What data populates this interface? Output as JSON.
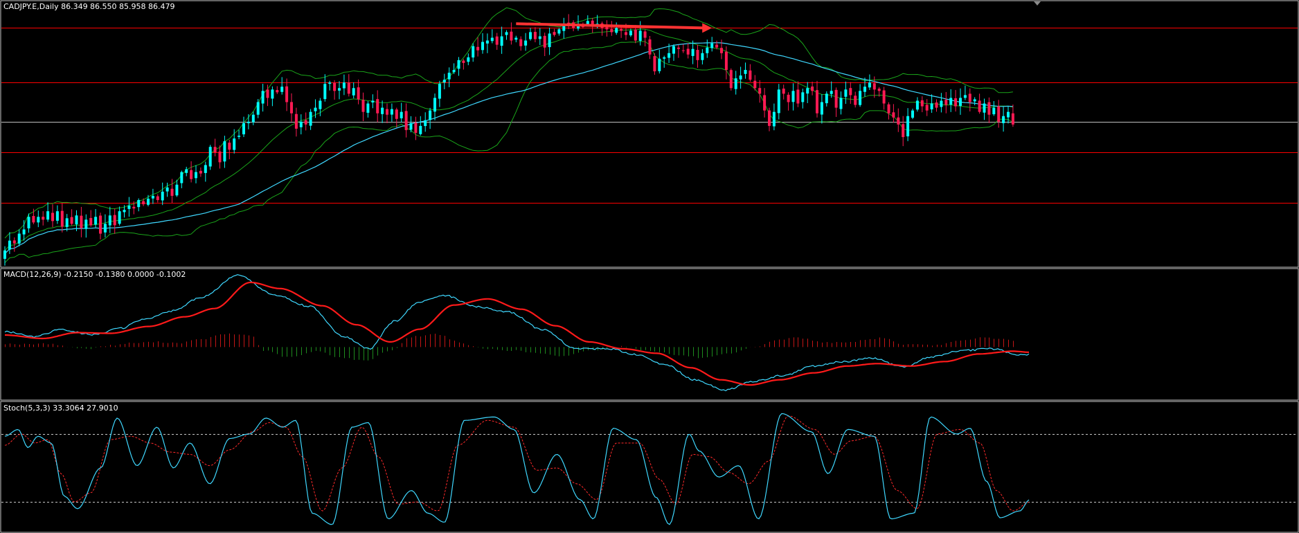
{
  "chart_data": [
    {
      "type": "candlestick",
      "panel": "price",
      "title": "CADJPY.E,Daily  86.349 86.550 85.958 86.479",
      "symbol": "CADJPY.E",
      "timeframe": "Daily",
      "ohlc_readout": [
        86.349,
        86.55,
        85.958,
        86.479
      ],
      "ylim": [
        80.0,
        89.3
      ],
      "horizontal_levels": [
        {
          "value": 88.45,
          "color": "#ff0000"
        },
        {
          "value": 86.5,
          "color": "#ff0000"
        },
        {
          "value": 85.1,
          "color": "#c0c0c0"
        },
        {
          "value": 84.0,
          "color": "#ff0000"
        },
        {
          "value": 82.2,
          "color": "#ff0000"
        }
      ],
      "arrow": {
        "from": {
          "bar": 107,
          "value": 88.6
        },
        "to": {
          "bar": 148,
          "value": 88.45
        },
        "color": "#ff3333"
      },
      "bollinger_period": 20,
      "bollinger_deviation": 2,
      "sma_period": 50,
      "colors": {
        "bull": "#00ffff",
        "bear": "#ff1a53",
        "bands": "#1aa51a",
        "sma": "#3fd8ff",
        "frame": "#c8c8c8",
        "background": "#000000"
      },
      "closes": [
        80.5,
        80.85,
        80.75,
        81.1,
        81.25,
        81.7,
        81.5,
        81.7,
        81.6,
        81.9,
        81.55,
        81.9,
        81.35,
        81.65,
        81.45,
        81.75,
        81.3,
        81.6,
        81.4,
        81.7,
        81.1,
        81.45,
        81.75,
        81.4,
        81.9,
        81.95,
        82.1,
        82.0,
        82.3,
        82.15,
        82.35,
        82.45,
        82.3,
        82.6,
        82.75,
        82.45,
        82.85,
        83.3,
        83.4,
        83.05,
        83.3,
        83.25,
        83.55,
        84.2,
        84.0,
        83.65,
        84.4,
        84.1,
        84.5,
        84.6,
        85.05,
        85.1,
        85.35,
        85.8,
        86.2,
        85.95,
        86.25,
        86.15,
        86.35,
        85.8,
        85.4,
        84.85,
        85.1,
        85.0,
        85.45,
        85.6,
        85.85,
        86.45,
        86.5,
        86.2,
        86.3,
        86.5,
        86.1,
        86.3,
        85.9,
        85.45,
        85.75,
        85.85,
        85.4,
        85.6,
        85.35,
        85.55,
        85.2,
        85.45,
        84.8,
        85.05,
        84.7,
        84.95,
        85.15,
        85.5,
        85.95,
        86.45,
        86.6,
        86.85,
        86.95,
        87.3,
        87.2,
        87.4,
        87.8,
        87.65,
        87.95,
        88.0,
        88.1,
        87.85,
        88.15,
        88.3,
        88.0,
        88.1,
        87.8,
        88.0,
        88.3,
        88.05,
        88.15,
        87.75,
        88.25,
        88.2,
        88.4,
        88.6,
        88.6,
        88.45,
        88.55,
        88.5,
        88.7,
        88.5,
        88.6,
        88.45,
        88.4,
        88.3,
        88.45,
        88.35,
        88.2,
        88.35,
        88.0,
        88.35,
        88.1,
        87.5,
        86.9,
        87.35,
        87.4,
        87.55,
        87.8,
        87.7,
        87.65,
        87.5,
        87.7,
        87.3,
        87.55,
        87.75,
        87.9,
        87.75,
        87.55,
        86.95,
        86.3,
        86.65,
        86.75,
        86.95,
        86.6,
        86.3,
        86.1,
        85.5,
        84.95,
        85.45,
        86.25,
        86.1,
        85.8,
        86.2,
        85.75,
        86.15,
        86.3,
        86.2,
        85.4,
        85.8,
        86.1,
        86.2,
        85.6,
        85.95,
        86.25,
        86.05,
        85.7,
        86.2,
        86.35,
        86.5,
        86.25,
        86.2,
        85.75,
        85.4,
        85.25,
        85.0,
        84.55,
        85.3,
        85.5,
        85.85,
        85.65,
        85.5,
        85.75,
        85.6,
        85.85,
        85.7,
        85.95,
        85.65,
        85.95,
        86.05,
        85.8,
        85.9,
        85.45,
        85.75,
        85.35,
        85.6,
        85.1,
        85.3,
        85.45,
        85.0
      ]
    },
    {
      "type": "line+bar",
      "panel": "macd",
      "title": "MACD(12,26,9) -0.2150 -0.1380 0.0000 -0.1002",
      "params": [
        12,
        26,
        9
      ],
      "readout": [
        -0.215,
        -0.138,
        0.0,
        -0.1002
      ],
      "ylim": [
        -1.5,
        2.2
      ],
      "colors": {
        "macd": "#3fd8ff",
        "signal": "#ff1a1a",
        "hist_positive": "#c41616",
        "hist_negative": "#1e8c1e"
      },
      "macd_control": [
        [
          0,
          0.45
        ],
        [
          14,
          0.3
        ],
        [
          26,
          0.5
        ],
        [
          42,
          0.36
        ],
        [
          55,
          0.55
        ],
        [
          65,
          0.8
        ],
        [
          79,
          1.05
        ],
        [
          93,
          1.45
        ],
        [
          110,
          2.08
        ],
        [
          128,
          1.5
        ],
        [
          144,
          1.18
        ],
        [
          160,
          0.3
        ],
        [
          172,
          -0.05
        ],
        [
          184,
          0.75
        ],
        [
          196,
          1.32
        ],
        [
          208,
          1.5
        ],
        [
          222,
          1.18
        ],
        [
          238,
          1.02
        ],
        [
          254,
          0.5
        ],
        [
          270,
          -0.05
        ],
        [
          286,
          -0.05
        ],
        [
          298,
          -0.22
        ],
        [
          312,
          -0.52
        ],
        [
          326,
          -0.95
        ],
        [
          340,
          -1.25
        ],
        [
          354,
          -0.99
        ],
        [
          368,
          -0.82
        ],
        [
          382,
          -0.55
        ],
        [
          396,
          -0.42
        ],
        [
          410,
          -0.32
        ],
        [
          424,
          -0.58
        ],
        [
          438,
          -0.28
        ],
        [
          452,
          -0.1
        ],
        [
          466,
          -0.05
        ],
        [
          480,
          -0.23
        ],
        [
          484,
          -0.22
        ]
      ],
      "signal_control": [
        [
          0,
          0.35
        ],
        [
          18,
          0.25
        ],
        [
          34,
          0.42
        ],
        [
          50,
          0.4
        ],
        [
          68,
          0.6
        ],
        [
          85,
          0.88
        ],
        [
          99,
          1.12
        ],
        [
          116,
          1.88
        ],
        [
          130,
          1.7
        ],
        [
          150,
          1.2
        ],
        [
          166,
          0.65
        ],
        [
          182,
          0.15
        ],
        [
          196,
          0.52
        ],
        [
          212,
          1.22
        ],
        [
          228,
          1.4
        ],
        [
          244,
          1.1
        ],
        [
          260,
          0.62
        ],
        [
          276,
          0.15
        ],
        [
          292,
          -0.05
        ],
        [
          308,
          -0.18
        ],
        [
          324,
          -0.6
        ],
        [
          338,
          -0.95
        ],
        [
          352,
          -1.1
        ],
        [
          366,
          -0.95
        ],
        [
          382,
          -0.75
        ],
        [
          398,
          -0.55
        ],
        [
          412,
          -0.48
        ],
        [
          428,
          -0.55
        ],
        [
          444,
          -0.42
        ],
        [
          460,
          -0.2
        ],
        [
          476,
          -0.12
        ],
        [
          484,
          -0.15
        ]
      ],
      "histogram_control": [
        [
          0,
          0.1
        ],
        [
          10,
          0.08
        ],
        [
          22,
          0.1
        ],
        [
          30,
          0.0
        ],
        [
          38,
          -0.05
        ],
        [
          50,
          0.05
        ],
        [
          60,
          0.12
        ],
        [
          72,
          0.15
        ],
        [
          82,
          0.12
        ],
        [
          92,
          0.22
        ],
        [
          104,
          0.38
        ],
        [
          116,
          0.35
        ],
        [
          122,
          -0.1
        ],
        [
          134,
          -0.3
        ],
        [
          148,
          -0.12
        ],
        [
          158,
          -0.3
        ],
        [
          170,
          -0.4
        ],
        [
          182,
          -0.1
        ],
        [
          192,
          0.3
        ],
        [
          204,
          0.38
        ],
        [
          216,
          0.1
        ],
        [
          226,
          -0.05
        ],
        [
          240,
          -0.1
        ],
        [
          252,
          -0.18
        ],
        [
          262,
          -0.28
        ],
        [
          276,
          -0.1
        ],
        [
          290,
          0.02
        ],
        [
          304,
          -0.1
        ],
        [
          320,
          -0.25
        ],
        [
          330,
          -0.32
        ],
        [
          342,
          -0.2
        ],
        [
          354,
          0.0
        ],
        [
          364,
          0.2
        ],
        [
          374,
          0.28
        ],
        [
          386,
          0.15
        ],
        [
          396,
          0.12
        ],
        [
          408,
          0.22
        ],
        [
          414,
          0.28
        ],
        [
          424,
          0.08
        ],
        [
          438,
          0.05
        ],
        [
          452,
          0.18
        ],
        [
          462,
          0.28
        ],
        [
          474,
          0.22
        ],
        [
          484,
          0.05
        ]
      ]
    },
    {
      "type": "line",
      "panel": "stochastic",
      "title": "Stoch(5,3,3) 33.3064 27.9010",
      "params": [
        5,
        3,
        3
      ],
      "readout": [
        33.3064,
        27.901
      ],
      "ylim": [
        -5,
        105
      ],
      "levels": [
        80,
        20
      ],
      "colors": {
        "main": "#3fd8ff",
        "signal": "#ff2a2a",
        "levels": "#c8c8c8"
      },
      "main_control": [
        [
          0,
          78
        ],
        [
          8,
          84
        ],
        [
          14,
          68
        ],
        [
          20,
          78
        ],
        [
          28,
          72
        ],
        [
          36,
          25
        ],
        [
          44,
          14
        ],
        [
          58,
          50
        ],
        [
          68,
          94
        ],
        [
          80,
          52
        ],
        [
          92,
          86
        ],
        [
          102,
          50
        ],
        [
          112,
          72
        ],
        [
          124,
          36
        ],
        [
          136,
          76
        ],
        [
          148,
          80
        ],
        [
          158,
          94
        ],
        [
          168,
          86
        ],
        [
          176,
          92
        ],
        [
          186,
          10
        ],
        [
          198,
          0
        ],
        [
          210,
          86
        ],
        [
          220,
          90
        ],
        [
          232,
          5
        ],
        [
          246,
          30
        ],
        [
          256,
          10
        ],
        [
          266,
          2
        ],
        [
          278,
          92
        ],
        [
          296,
          95
        ],
        [
          308,
          84
        ],
        [
          320,
          28
        ],
        [
          334,
          62
        ],
        [
          348,
          22
        ],
        [
          356,
          5
        ],
        [
          368,
          85
        ],
        [
          382,
          75
        ],
        [
          394,
          24
        ],
        [
          402,
          0
        ],
        [
          414,
          80
        ],
        [
          420,
          65
        ],
        [
          432,
          42
        ],
        [
          444,
          52
        ],
        [
          456,
          5
        ],
        [
          470,
          98
        ],
        [
          488,
          82
        ],
        [
          498,
          45
        ],
        [
          510,
          84
        ],
        [
          526,
          78
        ],
        [
          536,
          5
        ],
        [
          550,
          10
        ],
        [
          560,
          95
        ],
        [
          576,
          80
        ],
        [
          584,
          85
        ],
        [
          594,
          38
        ],
        [
          602,
          6
        ],
        [
          614,
          12
        ],
        [
          620,
          22
        ]
      ],
      "signal_control": [
        [
          0,
          70
        ],
        [
          10,
          80
        ],
        [
          18,
          72
        ],
        [
          26,
          75
        ],
        [
          34,
          45
        ],
        [
          42,
          20
        ],
        [
          52,
          28
        ],
        [
          64,
          75
        ],
        [
          76,
          78
        ],
        [
          88,
          72
        ],
        [
          100,
          64
        ],
        [
          112,
          62
        ],
        [
          124,
          52
        ],
        [
          136,
          66
        ],
        [
          150,
          82
        ],
        [
          160,
          90
        ],
        [
          170,
          86
        ],
        [
          180,
          60
        ],
        [
          192,
          12
        ],
        [
          204,
          50
        ],
        [
          216,
          86
        ],
        [
          226,
          60
        ],
        [
          238,
          18
        ],
        [
          250,
          20
        ],
        [
          262,
          12
        ],
        [
          274,
          70
        ],
        [
          292,
          92
        ],
        [
          308,
          86
        ],
        [
          322,
          48
        ],
        [
          334,
          50
        ],
        [
          346,
          36
        ],
        [
          358,
          22
        ],
        [
          370,
          72
        ],
        [
          384,
          72
        ],
        [
          396,
          40
        ],
        [
          406,
          18
        ],
        [
          416,
          62
        ],
        [
          426,
          60
        ],
        [
          438,
          46
        ],
        [
          450,
          36
        ],
        [
          462,
          56
        ],
        [
          474,
          96
        ],
        [
          490,
          84
        ],
        [
          502,
          62
        ],
        [
          512,
          74
        ],
        [
          526,
          78
        ],
        [
          540,
          30
        ],
        [
          552,
          14
        ],
        [
          564,
          80
        ],
        [
          578,
          84
        ],
        [
          590,
          72
        ],
        [
          600,
          30
        ],
        [
          610,
          12
        ],
        [
          620,
          20
        ]
      ]
    }
  ]
}
